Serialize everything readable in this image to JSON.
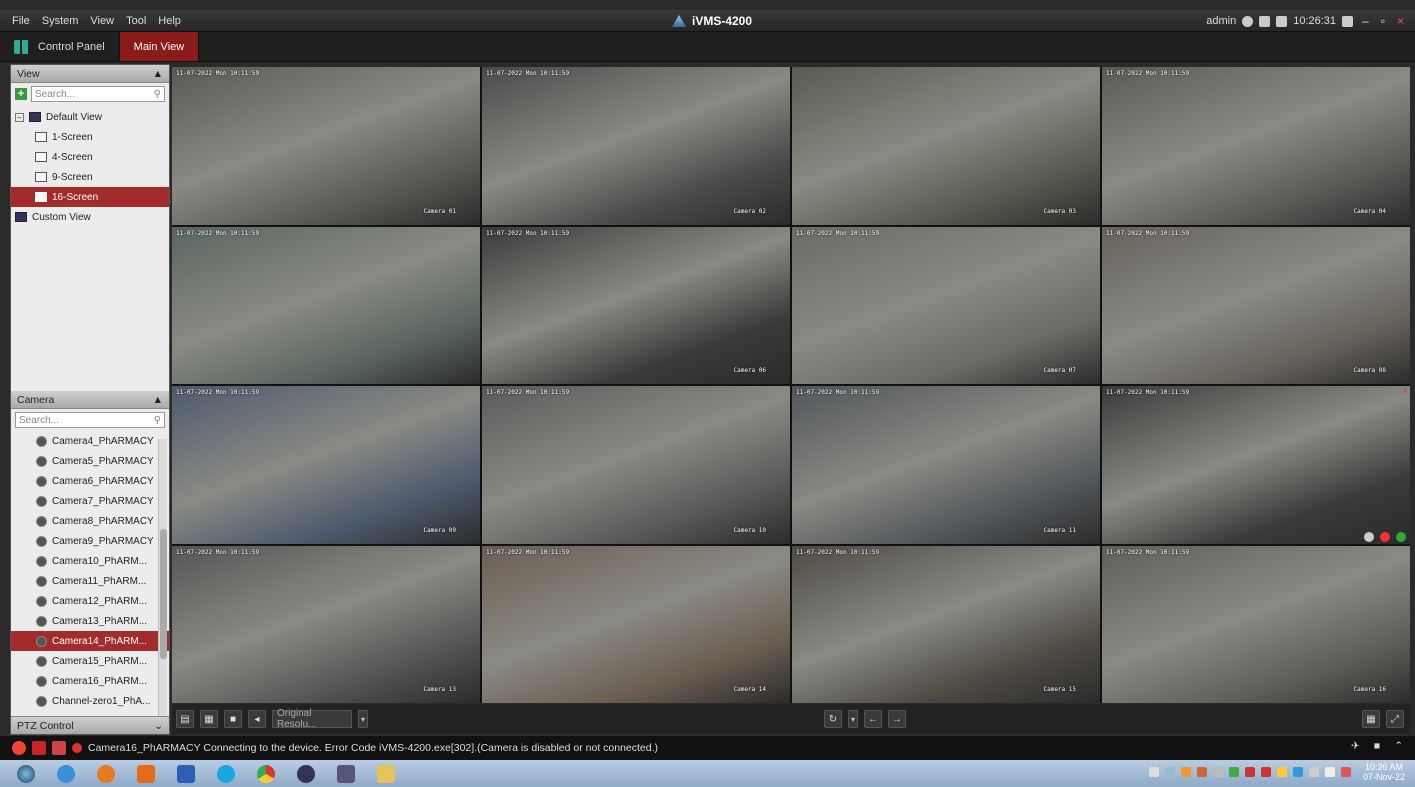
{
  "window": {
    "title": "iVMS-4200",
    "menu": [
      "File",
      "System",
      "View",
      "Tool",
      "Help"
    ],
    "user": "admin",
    "time": "10:26:31"
  },
  "tabs": [
    {
      "label": "Control Panel",
      "active": false
    },
    {
      "label": "Main View",
      "active": true
    }
  ],
  "view_panel": {
    "header": "View",
    "search_placeholder": "Search...",
    "tree": [
      {
        "label": "Default View",
        "level": 0
      },
      {
        "label": "1-Screen",
        "level": 1
      },
      {
        "label": "4-Screen",
        "level": 1
      },
      {
        "label": "9-Screen",
        "level": 1
      },
      {
        "label": "16-Screen",
        "level": 1,
        "selected": true
      },
      {
        "label": "Custom View",
        "level": 0
      }
    ]
  },
  "camera_panel": {
    "header": "Camera",
    "search_placeholder": "Search...",
    "items": [
      {
        "label": "Camera4_PhARMACY"
      },
      {
        "label": "Camera5_PhARMACY"
      },
      {
        "label": "Camera6_PhARMACY"
      },
      {
        "label": "Camera7_PhARMACY"
      },
      {
        "label": "Camera8_PhARMACY"
      },
      {
        "label": "Camera9_PhARMACY"
      },
      {
        "label": "Camera10_PhARM..."
      },
      {
        "label": "Camera11_PhARM..."
      },
      {
        "label": "Camera12_PhARM..."
      },
      {
        "label": "Camera13_PhARM..."
      },
      {
        "label": "Camera14_PhARM...",
        "selected": true
      },
      {
        "label": "Camera15_PhARM..."
      },
      {
        "label": "Camera16_PhARM..."
      },
      {
        "label": "Channel-zero1_PhA..."
      }
    ]
  },
  "ptz": {
    "label": "PTZ Control"
  },
  "grid": {
    "cells": [
      {
        "timestamp": "11-07-2022 Mon 10:11:59",
        "camera": "Camera 01",
        "tone": "#5a5a55"
      },
      {
        "timestamp": "11-07-2022 Mon 10:11:59",
        "camera": "Camera 02",
        "tone": "#4a4a4a"
      },
      {
        "timestamp": "",
        "camera": "Camera 03",
        "tone": "#5b5a50"
      },
      {
        "timestamp": "11-07-2022 Mon 10:11:59",
        "camera": "Camera 04",
        "tone": "#5c5a57"
      },
      {
        "timestamp": "11-07-2022 Mon 10:11:59",
        "camera": "",
        "tone": "#5a6660"
      },
      {
        "timestamp": "11-07-2022 Mon 10:11:59",
        "camera": "Camera 06",
        "tone": "#3a3a3a"
      },
      {
        "timestamp": "11-07-2022 Mon 10:11:59",
        "camera": "Camera 07",
        "tone": "#6a6a66"
      },
      {
        "timestamp": "11-07-2022 Mon 10:11:59",
        "camera": "Camera 08",
        "tone": "#66625c"
      },
      {
        "timestamp": "11-07-2022 Mon 10:11:59",
        "camera": "Camera 09",
        "tone": "#4d5a6d"
      },
      {
        "timestamp": "11-07-2022 Mon 10:11:59",
        "camera": "Camera 10",
        "tone": "#5a5a5a"
      },
      {
        "timestamp": "11-07-2022 Mon 10:11:59",
        "camera": "Camera 11",
        "tone": "#52565a"
      },
      {
        "timestamp": "11-07-2022 Mon 10:11:59",
        "camera": "",
        "tone": "#3a3a3a"
      },
      {
        "timestamp": "11-07-2022 Mon 10:11:59",
        "camera": "Camera 13",
        "tone": "#555"
      },
      {
        "timestamp": "11-07-2022 Mon 10:11:59",
        "camera": "Camera 14",
        "tone": "#6b5e52"
      },
      {
        "timestamp": "11-07-2022 Mon 10:11:59",
        "camera": "Camera 15",
        "tone": "#4e4a44"
      },
      {
        "timestamp": "11-07-2022 Mon 10:11:59",
        "camera": "Camera 16",
        "tone": "#5f5f5a"
      }
    ]
  },
  "toolbar": {
    "stream_dropdown": "Original Resolu..."
  },
  "status": {
    "message": "Camera16_PhARMACY Connecting to the device. Error Code iVMS-4200.exe[302].(Camera is disabled or not connected.)"
  },
  "taskbar": {
    "clock_time": "10:26 AM",
    "clock_date": "07-Nov-22"
  }
}
